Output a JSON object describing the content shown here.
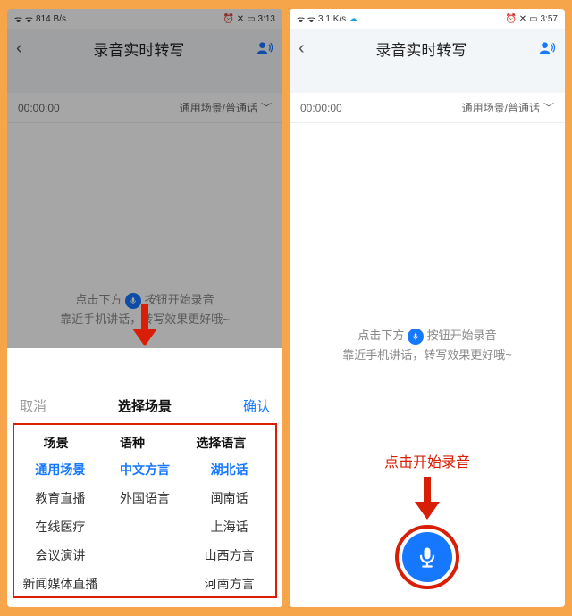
{
  "left": {
    "status": {
      "net": "814 B/s",
      "time": "3:13"
    },
    "nav": {
      "title": "录音实时转写"
    },
    "timer": "00:00:00",
    "scene_summary": "通用场景/普通话",
    "hint1a": "点击下方",
    "hint1b": "按钮开始录音",
    "hint2": "靠近手机讲话，转写效果更好哦~",
    "sheet": {
      "cancel": "取消",
      "title": "选择场景",
      "ok": "确认",
      "heads": {
        "c1": "场景",
        "c2": "语种",
        "c3": "选择语言"
      },
      "scene": {
        "selected": "通用场景",
        "o1": "教育直播",
        "o2": "在线医疗",
        "o3": "会议演讲",
        "o4": "新闻媒体直播"
      },
      "lang_kind": {
        "selected": "中文方言",
        "o1": "外国语言"
      },
      "lang": {
        "selected": "湖北话",
        "o1": "闽南话",
        "o2": "上海话",
        "o3": "山西方言",
        "o4": "河南方言"
      }
    }
  },
  "right": {
    "status": {
      "net": "3.1 K/s",
      "time": "3:57"
    },
    "nav": {
      "title": "录音实时转写"
    },
    "timer": "00:00:00",
    "scene_summary": "通用场景/普通话",
    "hint1a": "点击下方",
    "hint1b": "按钮开始录音",
    "hint2": "靠近手机讲话，转写效果更好哦~",
    "call_label": "点击开始录音"
  },
  "colors": {
    "accent": "#1677ff",
    "danger": "#d81e06",
    "frame": "#f7a54a"
  }
}
